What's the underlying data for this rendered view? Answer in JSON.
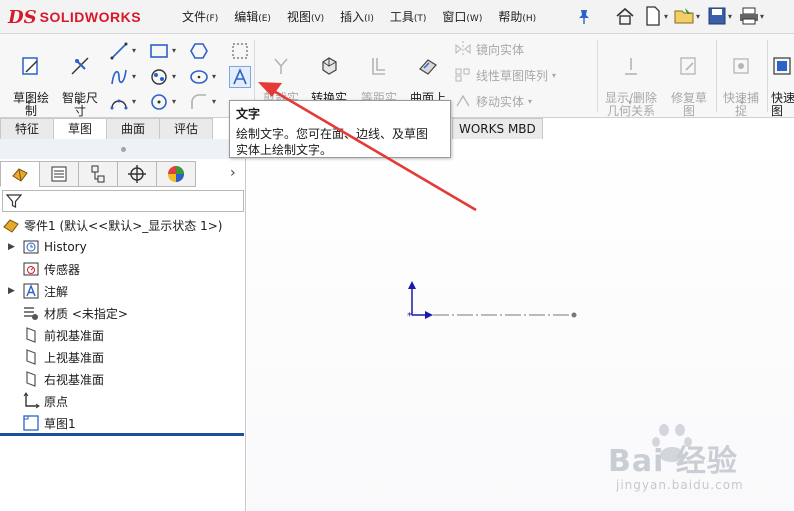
{
  "app": {
    "logo_ds": "DS",
    "logo_brand": "SOLIDWORKS"
  },
  "menu": [
    {
      "label": "文件",
      "key": "(F)"
    },
    {
      "label": "编辑",
      "key": "(E)"
    },
    {
      "label": "视图",
      "key": "(V)"
    },
    {
      "label": "插入",
      "key": "(I)"
    },
    {
      "label": "工具",
      "key": "(T)"
    },
    {
      "label": "窗口",
      "key": "(W)"
    },
    {
      "label": "帮助",
      "key": "(H)"
    }
  ],
  "quick_tools": [
    "home-icon",
    "new-document-icon",
    "open-folder-icon",
    "save-icon",
    "print-icon"
  ],
  "ribbon": {
    "sketch": "草图绘\n制",
    "smart_dim": "智能尺\n寸",
    "trim": "剪裁实\n体(T)",
    "convert": "转换实\n体引用",
    "offset": "等距实\n体",
    "surface_offset": "曲面上\n偏移",
    "mirror": "镜向实体",
    "linear_pattern": "线性草图阵列",
    "move": "移动实体",
    "display_delete": "显示/删除\n几何关系",
    "repair": "修复草\n图",
    "quick_snap": "快速捕\n捉",
    "quick_view": "快速\n图"
  },
  "tabs": [
    "特征",
    "草图",
    "曲面",
    "评估"
  ],
  "tab_extra": "WORKS MBD",
  "tooltip": {
    "title": "文字",
    "desc_line1": "绘制文字。您可在面、边线、及草图",
    "desc_line2": "实体上绘制文字。"
  },
  "tree": {
    "root": "零件1 (默认<<默认>_显示状态 1>)",
    "items": [
      {
        "label": "History",
        "icon": "history-icon",
        "expandable": true
      },
      {
        "label": "传感器",
        "icon": "sensor-icon",
        "expandable": false
      },
      {
        "label": "注解",
        "icon": "annotation-icon",
        "expandable": true
      },
      {
        "label": "材质 <未指定>",
        "icon": "material-icon",
        "expandable": false
      },
      {
        "label": "前视基准面",
        "icon": "plane-icon",
        "expandable": false
      },
      {
        "label": "上视基准面",
        "icon": "plane-icon",
        "expandable": false
      },
      {
        "label": "右视基准面",
        "icon": "plane-icon",
        "expandable": false
      },
      {
        "label": "原点",
        "icon": "origin-icon",
        "expandable": false
      },
      {
        "label": "草图1",
        "icon": "sketch-icon",
        "expandable": false
      }
    ]
  },
  "watermark": {
    "brand": "Bai 经验",
    "sub": "jingyan.baidu.com"
  },
  "colors": {
    "brand_red": "#d8182b",
    "tree_bar": "#1f4e9a",
    "arrow_red": "#e53935",
    "axis_blue": "#1a1aa8"
  }
}
